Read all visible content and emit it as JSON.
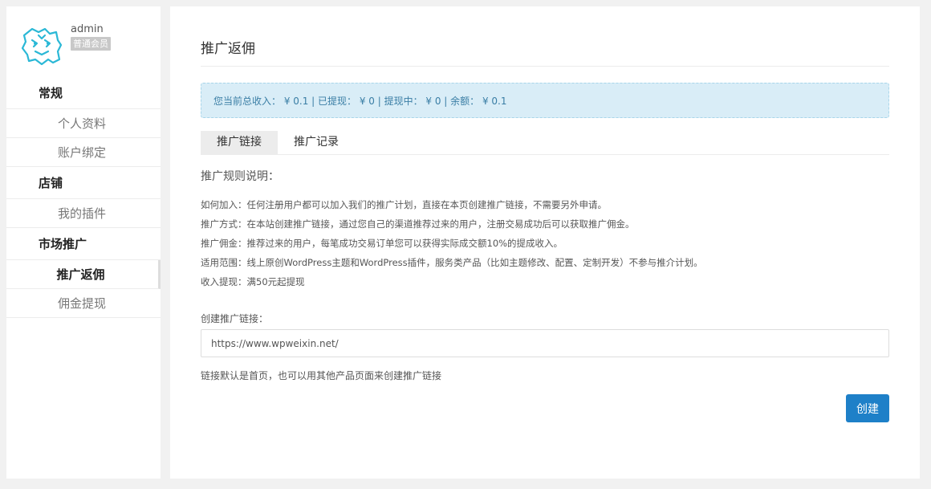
{
  "user": {
    "name": "admin",
    "role": "普通会员",
    "avatar_icon": "tiger-logo-icon"
  },
  "sidebar": {
    "groups": [
      {
        "label": "常规",
        "items": [
          {
            "label": "个人资料"
          },
          {
            "label": "账户绑定"
          }
        ]
      },
      {
        "label": "店铺",
        "items": [
          {
            "label": "我的插件"
          }
        ]
      },
      {
        "label": "市场推广",
        "items": [
          {
            "label": "推广返佣",
            "active": true
          },
          {
            "label": "佣金提现"
          }
        ]
      }
    ]
  },
  "main": {
    "title": "推广返佣",
    "summary": "您当前总收入： ¥ 0.1 | 已提现： ¥ 0 | 提现中： ¥ 0 | 余额： ¥ 0.1",
    "tabs": [
      {
        "label": "推广链接",
        "active": true
      },
      {
        "label": "推广记录"
      }
    ],
    "rules_title": "推广规则说明：",
    "rules": [
      "如何加入：任何注册用户都可以加入我们的推广计划，直接在本页创建推广链接，不需要另外申请。",
      "推广方式：在本站创建推广链接，通过您自己的渠道推荐过来的用户，注册交易成功后可以获取推广佣金。",
      "推广佣金：推荐过来的用户，每笔成功交易订单您可以获得实际成交额10%的提成收入。",
      "适用范围：线上原创WordPress主题和WordPress插件，服务类产品（比如主题修改、配置、定制开发）不参与推介计划。",
      "收入提现：满50元起提现"
    ],
    "form_label": "创建推广链接：",
    "url_value": "https://www.wpweixin.net/",
    "hint": "链接默认是首页，也可以用其他产品页面来创建推广链接",
    "create_button": "创建"
  },
  "colors": {
    "accent": "#1e80c8",
    "alert_bg": "#d9edf7",
    "avatar": "#2bb8d6"
  }
}
